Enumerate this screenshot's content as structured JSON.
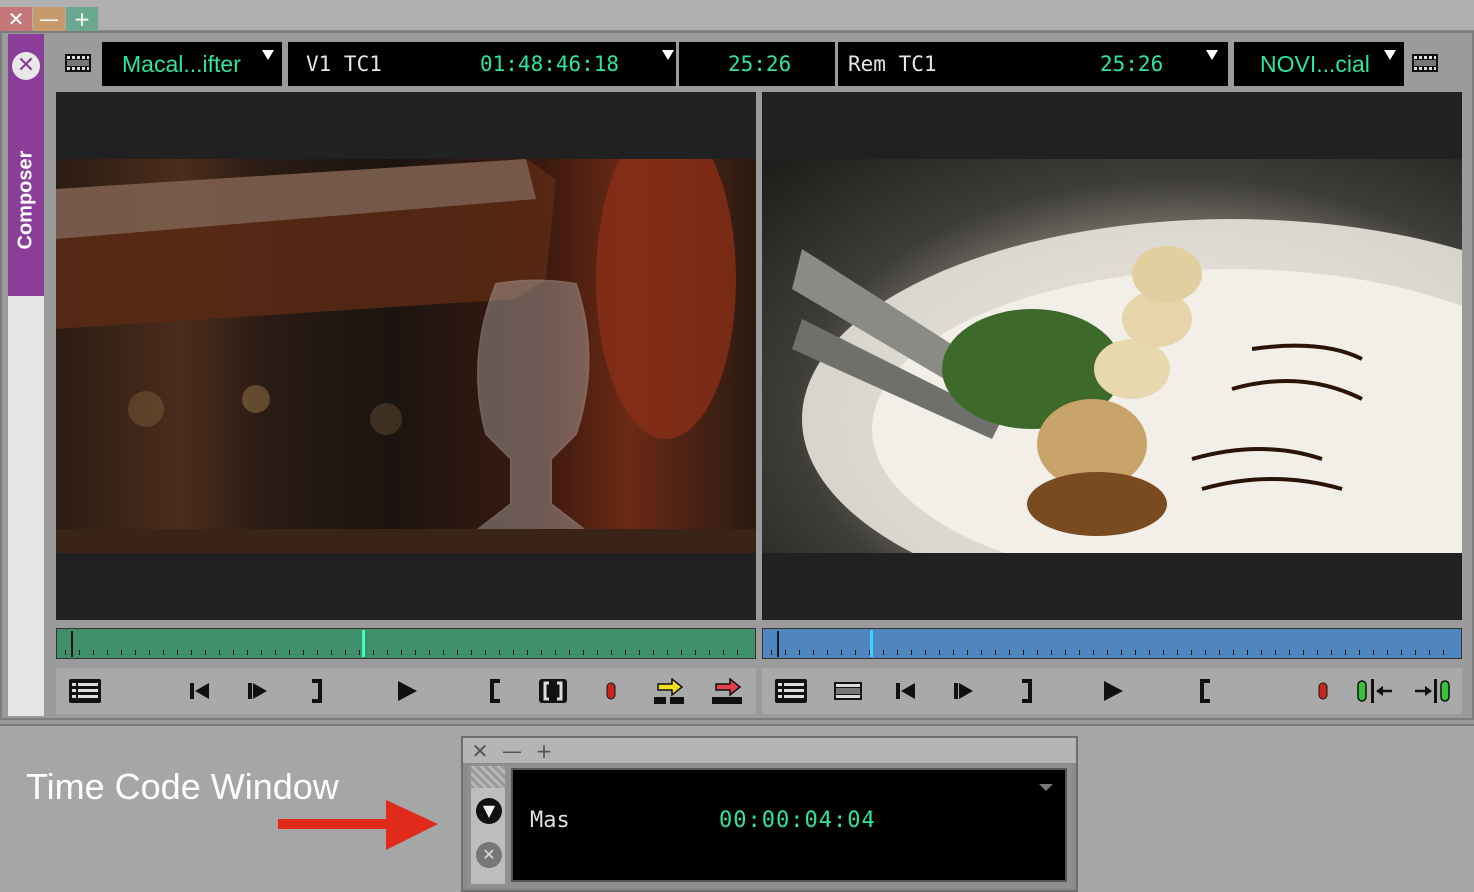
{
  "window": {
    "close_glyph": "✕",
    "minimize_glyph": "—",
    "maximize_glyph": "+"
  },
  "composer": {
    "tab_label": "Composer",
    "tab_close_glyph": "✕",
    "source_header": {
      "clip_name": "Macal...ifter",
      "track_label": "V1  TC1",
      "timecode": "01:48:46:18",
      "duration": "25:26"
    },
    "record_header": {
      "track_label": "Rem  TC1",
      "timecode": "25:26",
      "sequence_name": "NOVI...cial"
    },
    "source_position": 0.437,
    "record_position": 0.153,
    "source_controls": [
      "menu-icon",
      "step-back-icon",
      "step-forward-icon",
      "mark-out",
      "play-icon",
      "mark-in",
      "clear-marks-icon",
      "record-dot",
      "splice-in-icon",
      "overwrite-icon"
    ],
    "record_controls": [
      "menu-icon",
      "film-icon",
      "step-back-icon",
      "step-forward-icon",
      "mark-out",
      "play-icon",
      "mark-in",
      "record-dot",
      "trim-left-icon",
      "trim-right-icon"
    ],
    "colors": {
      "composer_tab": "#8b3d9a",
      "timecode_green": "#2ee59e",
      "source_bar": "#3e8f6a",
      "record_bar": "#4f86c0"
    }
  },
  "timecode_window": {
    "close_glyph": "✕",
    "minimize_glyph": "—",
    "maximize_glyph": "+",
    "label": "Mas",
    "value": "00:00:04:04"
  },
  "annotation": {
    "text": "Time Code Window"
  }
}
